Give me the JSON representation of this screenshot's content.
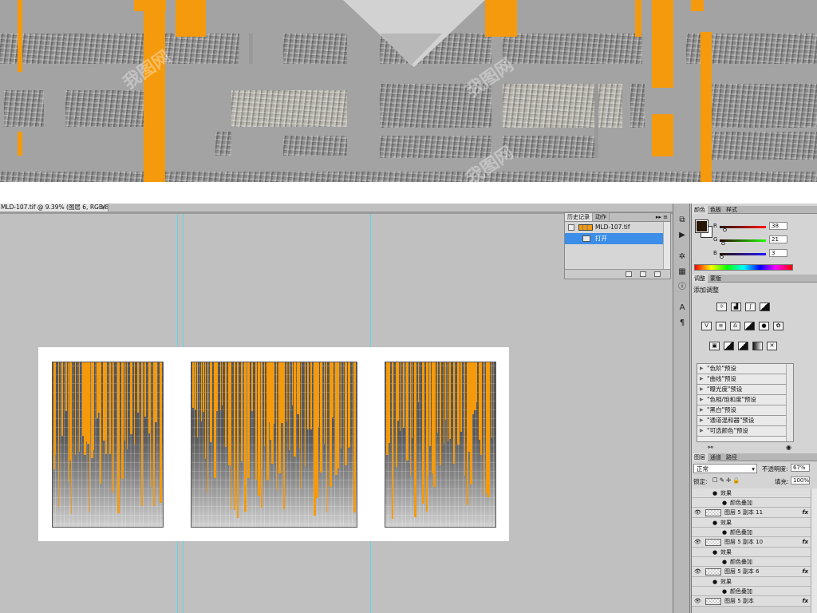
{
  "document": {
    "tab_title": "MLD-107.tif @ 9.39% (图层 6, RGB/8)",
    "close_glyph": "×",
    "drip_color": "#f59a0c"
  },
  "history_panel": {
    "tabs": [
      "历史记录",
      "动作"
    ],
    "menu_glyph": "▸▸ ≡",
    "snapshot_label": "MLD-107.tif",
    "steps": [
      {
        "label": "打开",
        "selected": true
      }
    ]
  },
  "color_panel": {
    "tabs": [
      "颜色",
      "色板",
      "样式"
    ],
    "foreground": "#261503",
    "channels": [
      {
        "name": "R",
        "value": "38",
        "color": "#c00000"
      },
      {
        "name": "G",
        "value": "21",
        "color": "#00a000"
      },
      {
        "name": "B",
        "value": "3",
        "color": "#0000c0"
      }
    ]
  },
  "adjustments_panel": {
    "tabs": [
      "调整",
      "蒙版"
    ],
    "title": "添加调整",
    "presets": [
      "\"色阶\"预设",
      "\"曲线\"预设",
      "\"曝光度\"预设",
      "\"色相/饱和度\"预设",
      "\"黑白\"预设",
      "\"通道混和器\"预设",
      "\"可选颜色\"预设"
    ]
  },
  "layers_panel": {
    "tabs": [
      "图层",
      "通道",
      "路径"
    ],
    "blend_mode": "正常",
    "opacity_label": "不透明度:",
    "opacity_value": "67%",
    "lock_label": "锁定:",
    "fill_label": "填充:",
    "fill_value": "100%",
    "rows": [
      {
        "type": "effects",
        "label": "效果"
      },
      {
        "type": "effect",
        "label": "颜色叠加"
      },
      {
        "type": "layer",
        "label": "图层 5 副本 11",
        "fx": "fx"
      },
      {
        "type": "effects",
        "label": "效果"
      },
      {
        "type": "effect",
        "label": "颜色叠加"
      },
      {
        "type": "layer",
        "label": "图层 5 副本 10",
        "fx": "fx"
      },
      {
        "type": "effects",
        "label": "效果"
      },
      {
        "type": "effect",
        "label": "颜色叠加"
      },
      {
        "type": "layer",
        "label": "图层 5 副本 6",
        "fx": "fx"
      },
      {
        "type": "effects",
        "label": "效果"
      },
      {
        "type": "effect",
        "label": "颜色叠加"
      },
      {
        "type": "layer",
        "label": "图层 5 副本",
        "fx": "fx"
      }
    ]
  },
  "watermark": "我图网"
}
